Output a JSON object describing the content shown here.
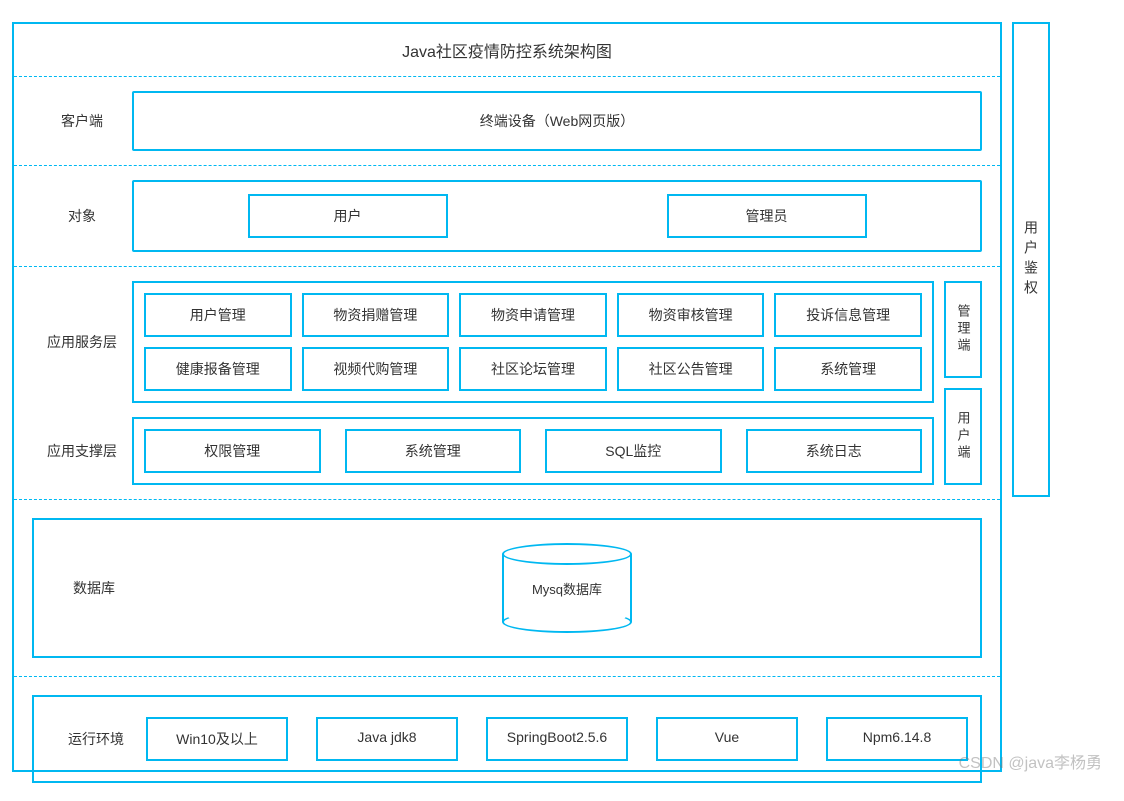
{
  "title": "Java社区疫情防控系统架构图",
  "rows": {
    "client": {
      "label": "客户端",
      "item": "终端设备（Web网页版）"
    },
    "object": {
      "label": "对象",
      "items": [
        "用户",
        "管理员"
      ]
    },
    "app_service": {
      "label": "应用服务层",
      "items_row1": [
        "用户管理",
        "物资捐赠管理",
        "物资申请管理",
        "物资审核管理",
        "投诉信息管理"
      ],
      "items_row2": [
        "健康报备管理",
        "视频代购管理",
        "社区论坛管理",
        "社区公告管理",
        "系统管理"
      ]
    },
    "app_support": {
      "label": "应用支撑层",
      "items": [
        "权限管理",
        "系统管理",
        "SQL监控",
        "系统日志"
      ]
    },
    "sidebar": {
      "admin": "管理端",
      "user": "用户端"
    },
    "database": {
      "label": "数据库",
      "item": "Mysq数据库"
    },
    "env": {
      "label": "运行环境",
      "items": [
        "Win10及以上",
        "Java jdk8",
        "SpringBoot2.5.6",
        "Vue",
        "Npm6.14.8"
      ]
    }
  },
  "right_column": "用户鉴权",
  "watermark": "CSDN @java李杨勇"
}
